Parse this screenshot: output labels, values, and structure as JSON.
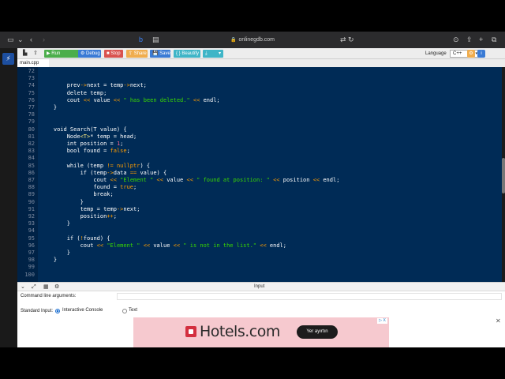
{
  "browser": {
    "url": "onlinegdb.com"
  },
  "toolbar": {
    "run": "Run",
    "debug": "Debug",
    "stop": "Stop",
    "share": "Share",
    "save": "Save",
    "beautify": "{ } Beautify",
    "language_label": "Language",
    "language_value": "C++"
  },
  "file_tab": "main.cpp",
  "code_lines": [
    {
      "n": "72",
      "t": ""
    },
    {
      "n": "73",
      "t": ""
    },
    {
      "n": "74",
      "t": "        prev->next = temp->next;"
    },
    {
      "n": "75",
      "t": "        delete temp;"
    },
    {
      "n": "76",
      "t": "        cout << value << \" has been deleted.\" << endl;"
    },
    {
      "n": "77",
      "t": "    }"
    },
    {
      "n": "78",
      "t": ""
    },
    {
      "n": "79",
      "t": ""
    },
    {
      "n": "80",
      "t": "    void Search(T value) {"
    },
    {
      "n": "81",
      "t": "        Node<T>* temp = head;"
    },
    {
      "n": "82",
      "t": "        int position = 1;"
    },
    {
      "n": "83",
      "t": "        bool found = false;"
    },
    {
      "n": "84",
      "t": ""
    },
    {
      "n": "85",
      "t": "        while (temp != nullptr) {"
    },
    {
      "n": "86",
      "t": "            if (temp->data == value) {"
    },
    {
      "n": "87",
      "t": "                cout << \"Element \" << value << \" found at position: \" << position << endl;"
    },
    {
      "n": "88",
      "t": "                found = true;"
    },
    {
      "n": "89",
      "t": "                break;"
    },
    {
      "n": "90",
      "t": "            }"
    },
    {
      "n": "91",
      "t": "            temp = temp->next;"
    },
    {
      "n": "92",
      "t": "            position++;"
    },
    {
      "n": "93",
      "t": "        }"
    },
    {
      "n": "94",
      "t": ""
    },
    {
      "n": "95",
      "t": "        if (!found) {"
    },
    {
      "n": "96",
      "t": "            cout << \"Element \" << value << \" is not in the list.\" << endl;"
    },
    {
      "n": "97",
      "t": "        }"
    },
    {
      "n": "98",
      "t": "    }"
    },
    {
      "n": "99",
      "t": ""
    },
    {
      "n": "100",
      "t": ""
    }
  ],
  "panel": {
    "title": "Input",
    "args_label": "Command line arguments:",
    "stdin_label": "Standard Input:",
    "option_interactive": "Interactive Console",
    "option_text": "Text"
  },
  "ad": {
    "brand": "Hotels.com",
    "button": "Yer ayırtın",
    "adchoice": "▷ X",
    "close": "✕"
  },
  "colors": {
    "editor_bg": "#002b56",
    "run_green": "#4cae4c",
    "debug_blue": "#3a7bd5",
    "stop_red": "#d9534f",
    "share_orange": "#f0ad4e",
    "beautify_teal": "#3fb5c7",
    "ad_bg": "#f6c9cf",
    "hotels_red": "#d32f3f"
  }
}
